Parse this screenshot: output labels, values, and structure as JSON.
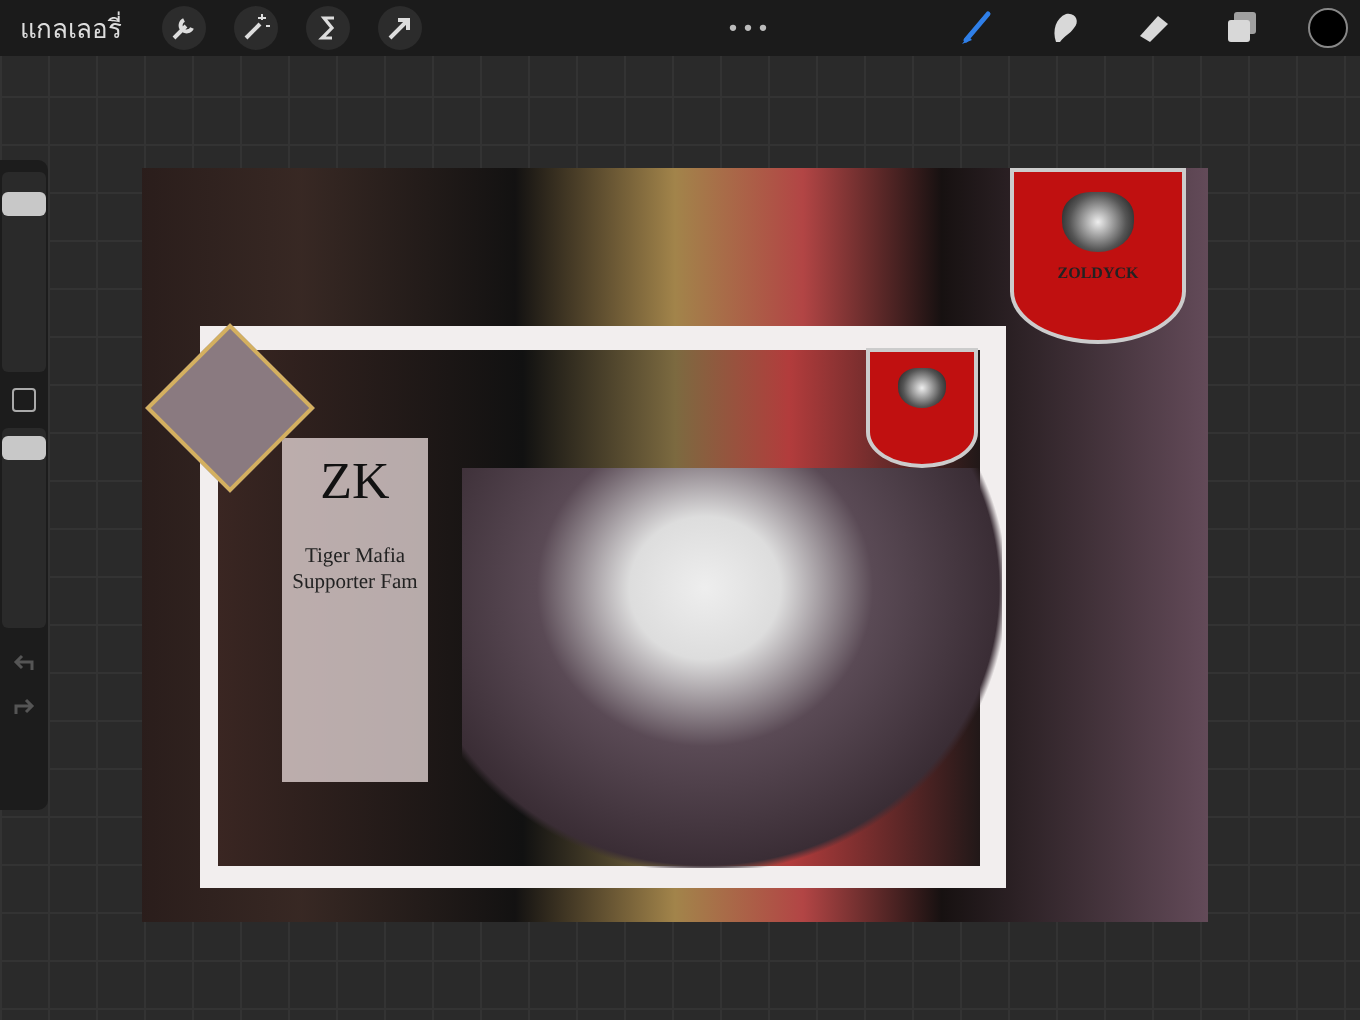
{
  "top_bar": {
    "gallery_label": "แกลเลอรี่",
    "more_label": "•••",
    "actions": [
      {
        "kind": "wrench"
      },
      {
        "kind": "wand"
      },
      {
        "kind": "select"
      },
      {
        "kind": "transform"
      }
    ],
    "tools": [
      {
        "kind": "brush",
        "selected": true
      },
      {
        "kind": "smudge",
        "selected": false
      },
      {
        "kind": "eraser",
        "selected": false
      },
      {
        "kind": "layers",
        "selected": false
      }
    ]
  },
  "sidebar": {
    "size_slider": {
      "level": 0.88
    },
    "opacity_slider": {
      "level": 0.95
    }
  },
  "artwork": {
    "emblem_label": "ZOLDYCK",
    "card_title": "ZK",
    "card_subtitle": "Tiger Mafia\nSupporter Fam"
  }
}
